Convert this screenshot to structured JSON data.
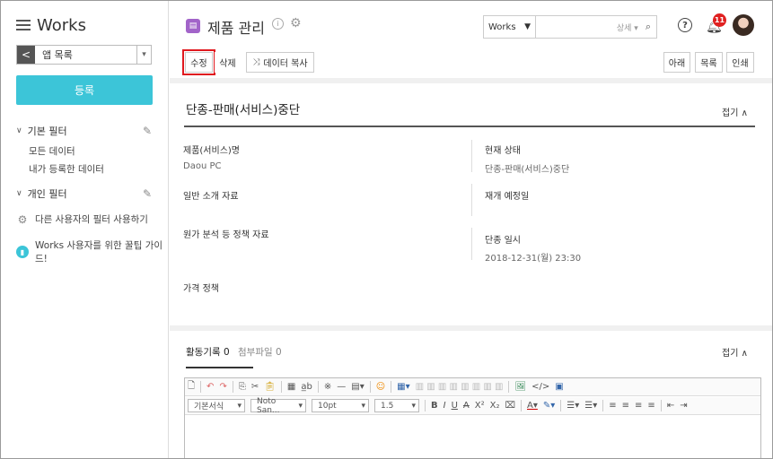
{
  "sidebar": {
    "brand": "Works",
    "app_select": "앱 목록",
    "register_button": "등록",
    "basic_filter": "기본 필터",
    "basic_items": [
      "모든 데이터",
      "내가 등록한 데이터"
    ],
    "personal_filter": "개인 필터",
    "use_other_filter": "다른 사용자의 필터 사용하기",
    "guide": "Works 사용자를 위한 꿀팁 가이드!"
  },
  "header": {
    "title": "제품 관리",
    "search_scope": "Works",
    "search_detail": "상세",
    "notification_count": "11",
    "buttons_left": [
      "수정",
      "삭제",
      "데이터 복사"
    ],
    "buttons_right": [
      "아래",
      "목록",
      "인쇄"
    ]
  },
  "section": {
    "title": "단종-판매(서비스)중단",
    "fold": "접기",
    "fields": [
      {
        "label": "제품(서비스)명",
        "value": "Daou PC"
      },
      {
        "label": "현재 상태",
        "value": "단종-판매(서비스)중단"
      },
      {
        "label": "일반 소개 자료",
        "value": ""
      },
      {
        "label": "재개 예정일",
        "value": ""
      },
      {
        "label": "원가 분석 등 정책 자료",
        "value": ""
      },
      {
        "label": "단종 일시",
        "value": "2018-12-31(월) 23:30"
      },
      {
        "label": "가격 정책",
        "value": ""
      }
    ]
  },
  "activity": {
    "tab_active": "활동기록 0",
    "tab_files": "첨부파일 0",
    "fold": "접기"
  },
  "editor": {
    "format": "기본서식",
    "font": "Noto San...",
    "size": "10pt",
    "line_height": "1.5"
  }
}
